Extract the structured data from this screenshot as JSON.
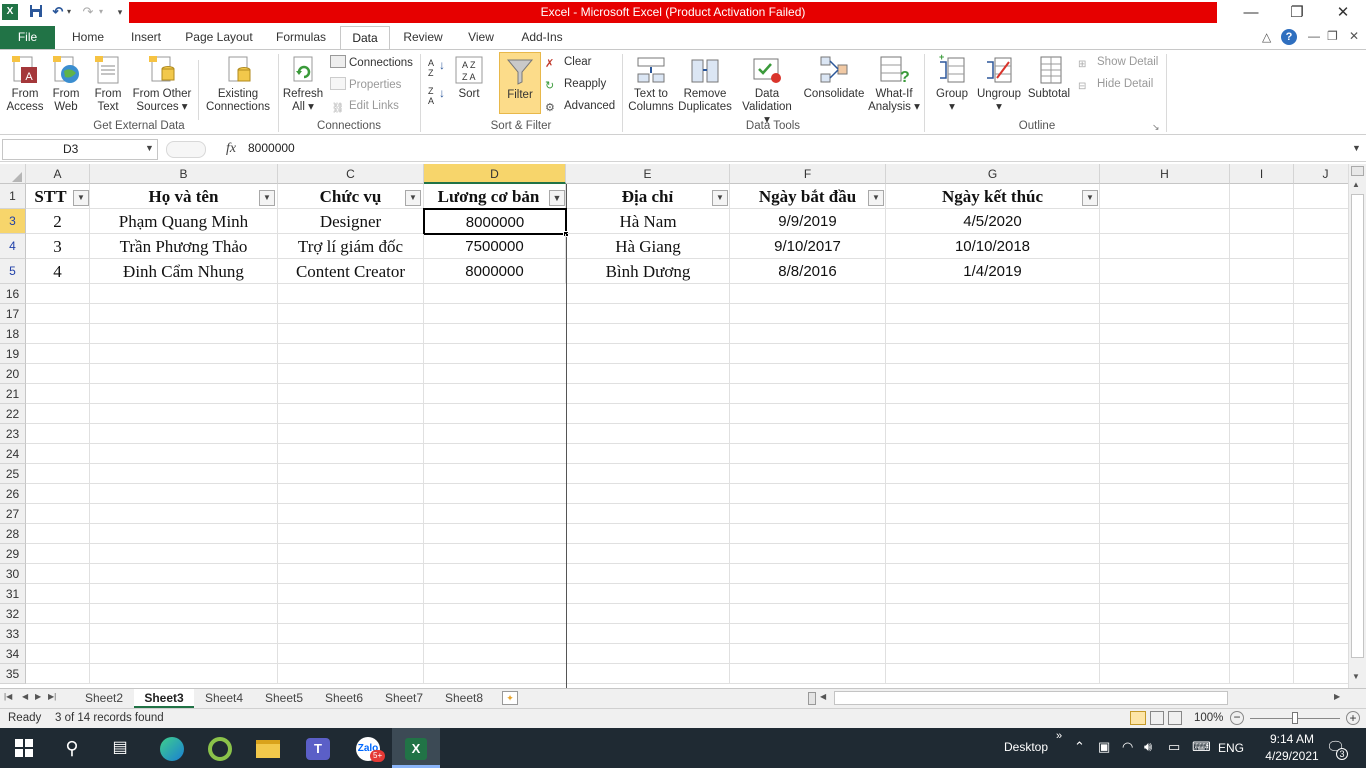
{
  "window": {
    "title": "Excel - Microsoft Excel (Product Activation Failed)",
    "minimize": "—",
    "restore": "❐",
    "close": "✕"
  },
  "qat": {
    "save": "💾",
    "undo": "↶",
    "redo": "↷"
  },
  "tabs": [
    "File",
    "Home",
    "Insert",
    "Page Layout",
    "Formulas",
    "Data",
    "Review",
    "View",
    "Add-Ins"
  ],
  "ribbon": {
    "from_access": [
      "From",
      "Access"
    ],
    "from_web": [
      "From",
      "Web"
    ],
    "from_text": [
      "From",
      "Text"
    ],
    "from_other": [
      "From Other",
      "Sources ▾"
    ],
    "existing": [
      "Existing",
      "Connections"
    ],
    "refresh": [
      "Refresh",
      "All ▾"
    ],
    "connections": "Connections",
    "properties": "Properties",
    "edit_links": "Edit Links",
    "sort": "Sort",
    "filter": "Filter",
    "clear": "Clear",
    "reapply": "Reapply",
    "advanced": "Advanced",
    "text_to_columns": [
      "Text to",
      "Columns"
    ],
    "remove_duplicates": [
      "Remove",
      "Duplicates"
    ],
    "data_validation": [
      "Data",
      "Validation ▾"
    ],
    "consolidate": "Consolidate",
    "what_if": [
      "What-If",
      "Analysis ▾"
    ],
    "group": [
      "Group",
      "▾"
    ],
    "ungroup": [
      "Ungroup",
      "▾"
    ],
    "subtotal": "Subtotal",
    "show_detail": "Show Detail",
    "hide_detail": "Hide Detail",
    "groups": {
      "get_external": "Get External Data",
      "connections": "Connections",
      "sort_filter": "Sort & Filter",
      "data_tools": "Data Tools",
      "outline": "Outline"
    }
  },
  "formula_bar": {
    "name_box": "D3",
    "fx": "fx",
    "value": "8000000"
  },
  "columns": [
    "A",
    "B",
    "C",
    "D",
    "E",
    "F",
    "G",
    "H",
    "I",
    "J"
  ],
  "rows": [
    "1",
    "3",
    "4",
    "5",
    "16",
    "17",
    "18",
    "19",
    "20",
    "21",
    "22",
    "23",
    "24",
    "25",
    "26",
    "27",
    "28",
    "29",
    "30",
    "31",
    "32",
    "33",
    "34",
    "35"
  ],
  "table": {
    "headers": [
      "STT",
      "Họ và tên",
      "Chức vụ",
      "Lương cơ bản",
      "Địa chỉ",
      "Ngày bắt đầu",
      "Ngày kết thúc"
    ],
    "rows": [
      [
        "2",
        "Phạm Quang Minh",
        "Designer",
        "8000000",
        "Hà Nam",
        "9/9/2019",
        "4/5/2020"
      ],
      [
        "3",
        "Trần Phương Thảo",
        "Trợ lí giám đốc",
        "7500000",
        "Hà Giang",
        "9/10/2017",
        "10/10/2018"
      ],
      [
        "4",
        "Đinh Cẩm Nhung",
        "Content Creator",
        "8000000",
        "Bình Dương",
        "8/8/2016",
        "1/4/2019"
      ]
    ]
  },
  "sheets": [
    "Sheet2",
    "Sheet3",
    "Sheet4",
    "Sheet5",
    "Sheet6",
    "Sheet7",
    "Sheet8"
  ],
  "active_sheet": "Sheet3",
  "status": {
    "ready": "Ready",
    "records": "3 of 14 records found",
    "zoom": "100%"
  },
  "taskbar": {
    "desktop": "Desktop",
    "lang": "ENG",
    "time": "9:14 AM",
    "date": "4/29/2021",
    "notif_count": "3",
    "zalo_badge": "5+"
  }
}
